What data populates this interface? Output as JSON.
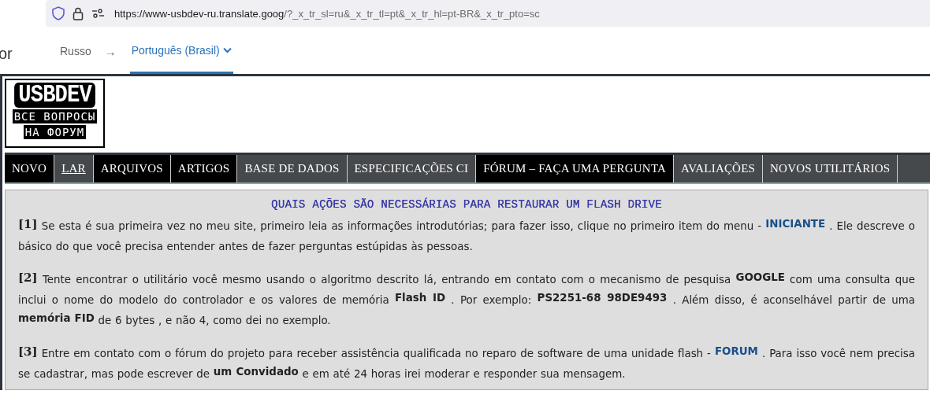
{
  "address_bar": {
    "url_host": "https://www-usbdev-ru.translate.goog",
    "url_path": "/?_x_tr_sl=ru&_x_tr_tl=pt&_x_tr_hl=pt-BR&_x_tr_pto=sc"
  },
  "translate_bar": {
    "cut_title": "or",
    "source_language": "Russo",
    "arrow": "→",
    "target_language": "Português (Brasil)"
  },
  "logo": {
    "title": "USBDEV",
    "line_1": "ВСЕ ВОПРОСЫ",
    "line_2": "НА ФОРУМ"
  },
  "nav": [
    {
      "label": "NOVO",
      "color": "#000000",
      "selected": false
    },
    {
      "label": "LAR",
      "color": "#46494c",
      "selected": true
    },
    {
      "label": "ARQUIVOS",
      "color": "#000000",
      "selected": false
    },
    {
      "label": "ARTIGOS",
      "color": "#000000",
      "selected": false
    },
    {
      "label": "BASE DE DADOS",
      "color": "#46494c",
      "selected": false
    },
    {
      "label": "ESPECIFICAÇÕES CI",
      "color": "#46494c",
      "selected": false
    },
    {
      "label": "FÓRUM – FAÇA UMA PERGUNTA",
      "color": "#000000",
      "selected": false
    },
    {
      "label": "AVALIAÇÕES",
      "color": "#46494c",
      "selected": false
    },
    {
      "label": "NOVOS UTILITÁRIOS",
      "color": "#46494c",
      "selected": false
    }
  ],
  "content": {
    "heading": "QUAIS AÇÕES SÃO NECESSÁRIAS PARA RESTAURAR UM FLASH DRIVE",
    "paragraphs": [
      {
        "number": "[1]",
        "parts": [
          {
            "kind": "text",
            "text": "Se esta é sua primeira vez no meu site, primeiro leia as informações introdutórias; para fazer isso, clique no primeiro item do menu - "
          },
          {
            "kind": "link",
            "text": "INICIANTE"
          },
          {
            "kind": "text",
            "text": " . Ele descreve o básico do que você precisa entender antes de fazer perguntas estúpidas às pessoas."
          }
        ]
      },
      {
        "number": "[2]",
        "parts": [
          {
            "kind": "text",
            "text": "Tente encontrar o utilitário você mesmo usando o algoritmo descrito lá, entrando em contato com o mecanismo de pesquisa "
          },
          {
            "kind": "bold",
            "text": "GOOGLE"
          },
          {
            "kind": "text",
            "text": " com uma consulta que inclui o nome do modelo do controlador e os valores de memória "
          },
          {
            "kind": "bold",
            "text": "Flash ID"
          },
          {
            "kind": "text",
            "text": " . Por exemplo: "
          },
          {
            "kind": "bold",
            "text": "PS2251-68 98DE9493"
          },
          {
            "kind": "text",
            "text": " . Além disso, é aconselhável partir de uma "
          },
          {
            "kind": "bold",
            "text": "memória FID"
          },
          {
            "kind": "text",
            "text": " de 6 bytes , e não 4, como dei no exemplo."
          }
        ]
      },
      {
        "number": "[3]",
        "parts": [
          {
            "kind": "text",
            "text": "Entre em contato com o fórum do projeto para receber assistência qualificada no reparo de software de uma unidade flash - "
          },
          {
            "kind": "link",
            "text": "FORUM"
          },
          {
            "kind": "text",
            "text": " . Para isso você nem precisa se cadastrar, mas pode escrever de "
          },
          {
            "kind": "bold",
            "text": "um Convidado"
          },
          {
            "kind": "text",
            "text": " e em até 24 horas irei moderar e responder sua mensagem."
          }
        ]
      }
    ]
  }
}
